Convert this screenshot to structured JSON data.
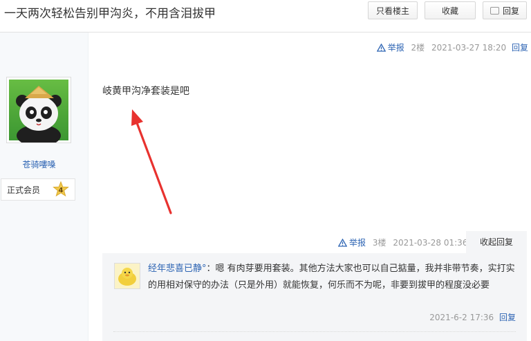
{
  "header": {
    "title": "一天两次轻松告别甲沟炎，不用含泪拔甲",
    "only_op_label": "只看楼主",
    "favorite_label": "收藏",
    "reply_label": "回复"
  },
  "author": {
    "name": "苍骑嘍嗓",
    "member_label": "正式会员",
    "level": "4"
  },
  "post": {
    "report_label": "举报",
    "floor": "2楼",
    "time": "2021-03-27 18:20",
    "reply_label": "回复",
    "content": "岐黄甲沟净套装是吧"
  },
  "floor3": {
    "report_label": "举报",
    "floor": "3楼",
    "time": "2021-03-28 01:36",
    "collapse_label": "收起回复"
  },
  "nested_reply": {
    "user": "经年悲喜已静°",
    "text": "：嗯 有肉芽要用套装。其他方法大家也可以自己掂量，我并非带节奏，实打实的用相对保守的办法（只是外用）就能恢复，何乐而不为呢，非要到拔甲的程度没必要",
    "time": "2021-6-2 17:36",
    "reply_label": "回复"
  },
  "colors": {
    "link": "#2d64b3",
    "arrow": "#e8322f",
    "sidebar_bg": "#f7f9fb"
  }
}
